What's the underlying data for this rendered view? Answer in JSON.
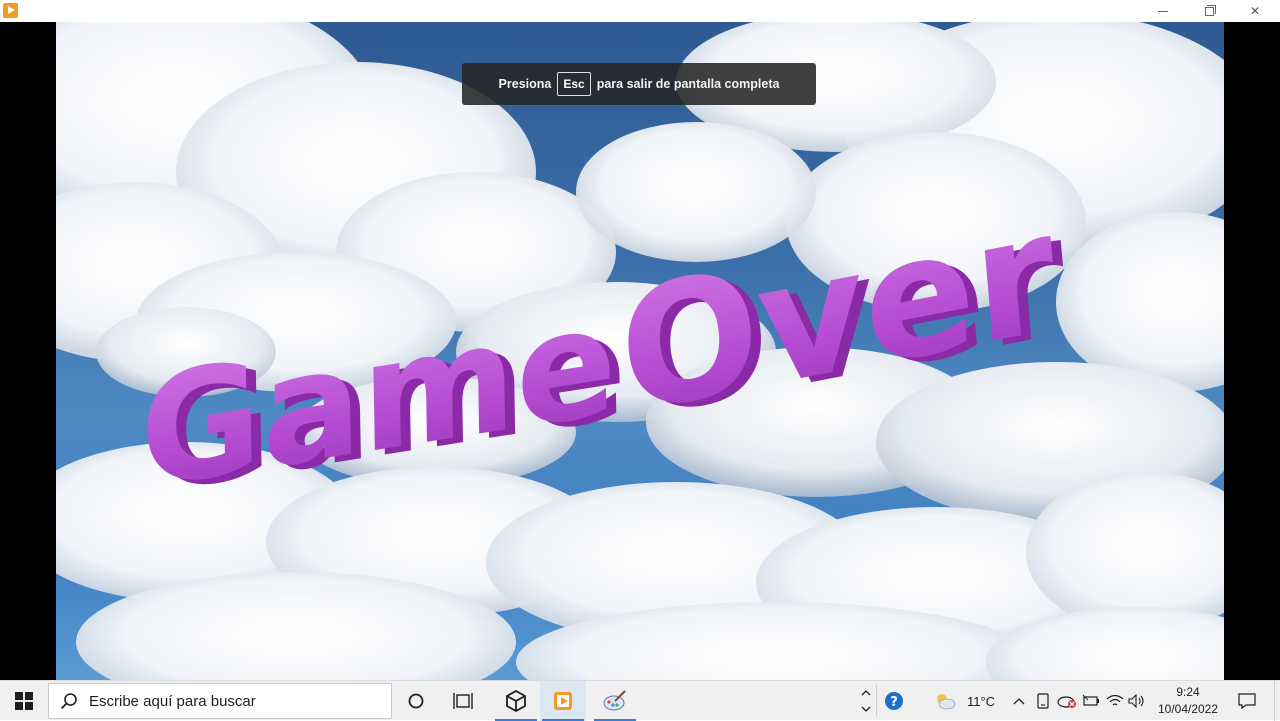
{
  "window": {
    "app_icon": "play-icon",
    "controls": [
      "minimize-icon",
      "maximize-icon",
      "close-icon"
    ]
  },
  "game": {
    "fullscreen_toast": {
      "prefix": "Presiona",
      "key": "Esc",
      "suffix": "para salir de pantalla completa"
    },
    "title_word_1": "Game",
    "title_word_2": "Over",
    "title_color": "#b44ad0",
    "sky_color": "#3a72b0"
  },
  "taskbar": {
    "search_placeholder": "Escribe aquí para buscar",
    "pinned": [
      "task-view-icon",
      "timeline-icon",
      "unity-icon",
      "play-app-icon",
      "paint-icon"
    ],
    "tray": {
      "temperature": "11°C",
      "time": "9:24",
      "date": "10/04/2022"
    },
    "accent": "#3b7dd8"
  }
}
